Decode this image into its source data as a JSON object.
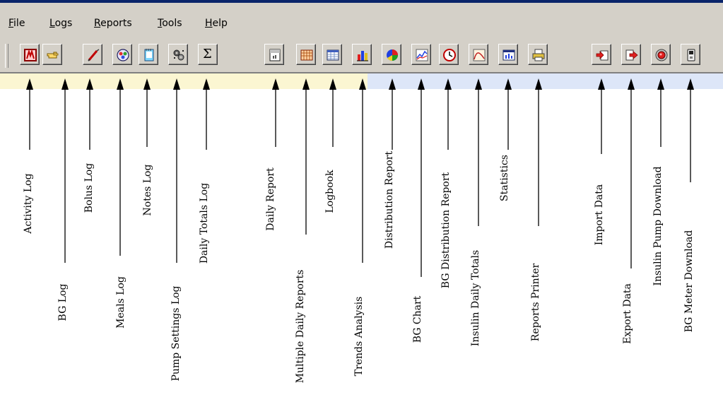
{
  "menu": [
    {
      "label": "File",
      "accel": "F",
      "rest": "ile"
    },
    {
      "label": "Logs",
      "accel": "L",
      "rest": "ogs"
    },
    {
      "label": "Reports",
      "accel": "R",
      "rest": "eports"
    },
    {
      "label": "Tools",
      "accel": "T",
      "rest": "ools"
    },
    {
      "label": "Help",
      "accel": "H",
      "rest": "elp"
    }
  ],
  "toolbar_buttons": [
    {
      "icon": "activity-log-icon",
      "label": "Activity Log"
    },
    {
      "icon": "bg-log-icon",
      "label": "BG Log"
    },
    {
      "icon": "bolus-log-icon",
      "label": "Bolus Log"
    },
    {
      "icon": "meals-log-icon",
      "label": "Meals Log"
    },
    {
      "icon": "notes-log-icon",
      "label": "Notes Log"
    },
    {
      "icon": "pump-settings-log-icon",
      "label": "Pump Settings Log"
    },
    {
      "icon": "daily-totals-log-icon",
      "label": "Daily Totals Log"
    },
    {
      "icon": "daily-report-icon",
      "label": "Daily Report"
    },
    {
      "icon": "multiple-daily-reports-icon",
      "label": "Multiple Daily Reports"
    },
    {
      "icon": "logbook-icon",
      "label": "Logbook"
    },
    {
      "icon": "trends-analysis-icon",
      "label": "Trends Analysis"
    },
    {
      "icon": "distribution-report-icon",
      "label": "Distribution Report"
    },
    {
      "icon": "bg-chart-icon",
      "label": "BG Chart"
    },
    {
      "icon": "bg-distribution-report-icon",
      "label": "BG Distribution Report"
    },
    {
      "icon": "insulin-daily-totals-icon",
      "label": "Insulin Daily Totals"
    },
    {
      "icon": "statistics-icon",
      "label": "Statistics"
    },
    {
      "icon": "reports-printer-icon",
      "label": "Reports Printer"
    },
    {
      "icon": "import-data-icon",
      "label": "Import Data"
    },
    {
      "icon": "export-data-icon",
      "label": "Export Data"
    },
    {
      "icon": "insulin-pump-download-icon",
      "label": "Insulin Pump Download"
    },
    {
      "icon": "bg-meter-download-icon",
      "label": "BG Meter Download"
    }
  ],
  "daily_totals_glyph": "Σ",
  "calendar_glyph": "JAN 1",
  "colors": {
    "menubar_bg": "#d4d0c8",
    "strip_left": "#fbf6d2",
    "strip_right": "#dde6f8"
  }
}
